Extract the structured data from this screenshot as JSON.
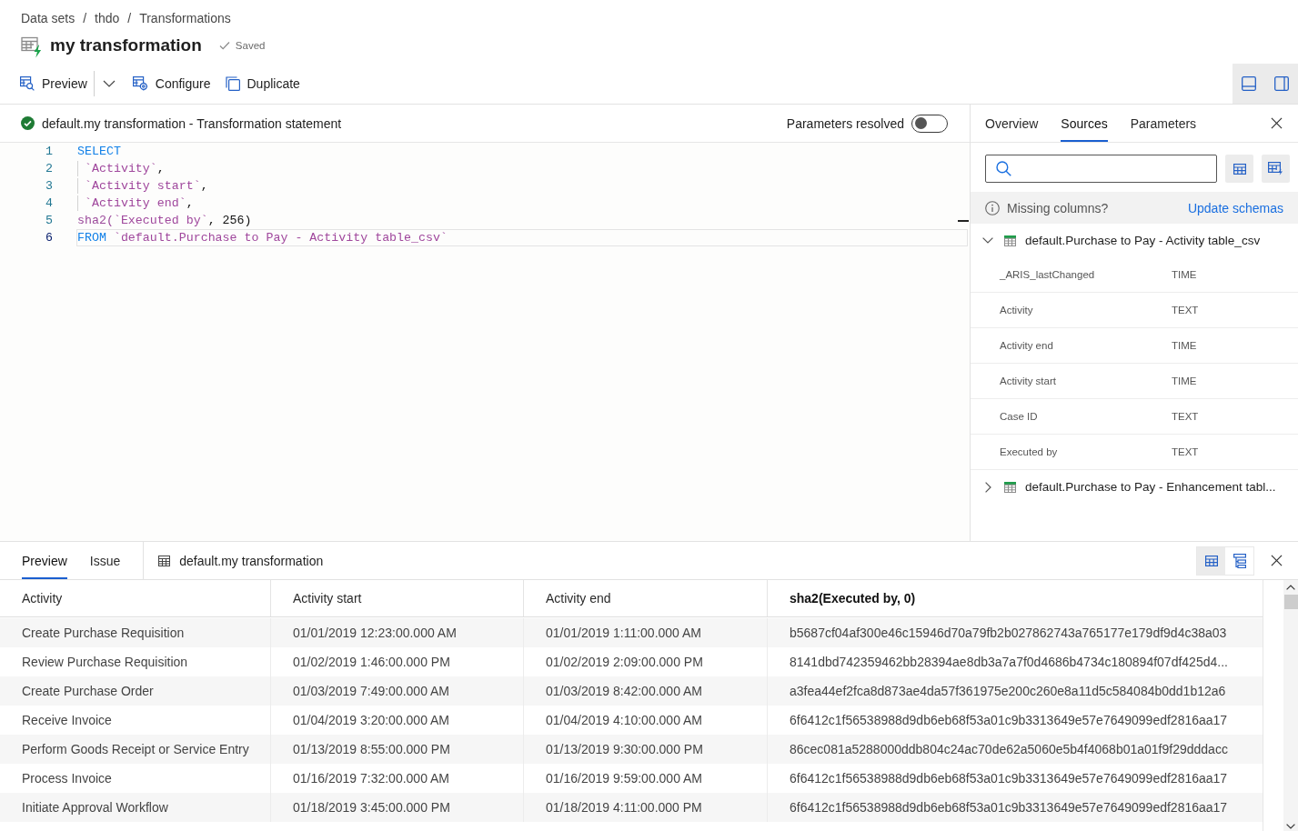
{
  "breadcrumb": {
    "separator": "/",
    "items": [
      "Data sets",
      "thdo",
      "Transformations"
    ]
  },
  "title": "my transformation",
  "save_status": "Saved",
  "toolbar": [
    {
      "kind": "preview",
      "label": "Preview"
    },
    {
      "kind": "dropdown"
    },
    {
      "kind": "configure",
      "label": "Configure"
    },
    {
      "kind": "duplicate",
      "label": "Duplicate"
    }
  ],
  "layout_toggles": [
    {
      "kind": "bottom-panel",
      "selected": true
    },
    {
      "kind": "side-panel",
      "selected": true
    }
  ],
  "editor": {
    "statement": {
      "title": "default.my transformation - Transformation statement",
      "valid": true
    },
    "parameters_resolved": {
      "label": "Parameters resolved",
      "on": false
    },
    "lines": [
      {
        "number": "1",
        "current": false,
        "indented": false,
        "tokens": [
          {
            "kind": "keyword",
            "text": "SELECT"
          }
        ]
      },
      {
        "number": "2",
        "current": false,
        "indented": true,
        "tokens": [
          {
            "kind": "string",
            "text": "`Activity`"
          },
          {
            "kind": "plain",
            "text": ","
          }
        ]
      },
      {
        "number": "3",
        "current": false,
        "indented": true,
        "tokens": [
          {
            "kind": "string",
            "text": "`Activity start`"
          },
          {
            "kind": "plain",
            "text": ","
          }
        ]
      },
      {
        "number": "4",
        "current": false,
        "indented": true,
        "tokens": [
          {
            "kind": "string",
            "text": "`Activity end`"
          },
          {
            "kind": "plain",
            "text": ","
          }
        ]
      },
      {
        "number": "5",
        "current": false,
        "indented": false,
        "tokens": [
          {
            "kind": "function",
            "text": "sha2("
          },
          {
            "kind": "string",
            "text": "`Executed by`"
          },
          {
            "kind": "plain",
            "text": ", 256)"
          }
        ]
      },
      {
        "number": "6",
        "current": true,
        "indented": false,
        "tokens": [
          {
            "kind": "keyword",
            "text": "FROM"
          },
          {
            "kind": "string",
            "text": " `default.Purchase to Pay - Activity table_csv`"
          }
        ]
      }
    ]
  },
  "side_panel": {
    "tabs": [
      {
        "label": "Overview",
        "selected": false
      },
      {
        "label": "Sources",
        "selected": true
      },
      {
        "label": "Parameters",
        "selected": false
      }
    ],
    "notice": {
      "text": "Missing columns?",
      "link": "Update schemas"
    },
    "sources": [
      {
        "name": "default.Purchase to Pay - Activity table_csv",
        "expanded": true,
        "children": [
          {
            "name": "_ARIS_lastChanged",
            "type": "TIME"
          },
          {
            "name": "Activity",
            "type": "TEXT"
          },
          {
            "name": "Activity end",
            "type": "TIME"
          },
          {
            "name": "Activity start",
            "type": "TIME"
          },
          {
            "name": "Case ID",
            "type": "TEXT"
          },
          {
            "name": "Executed by",
            "type": "TEXT"
          }
        ]
      },
      {
        "name": "default.Purchase to Pay - Enhancement tabl...",
        "expanded": false
      }
    ]
  },
  "bottom_panel": {
    "tabs": [
      {
        "label": "Preview",
        "selected": true
      },
      {
        "label": "Issue",
        "selected": false
      }
    ],
    "result_name": "default.my transformation",
    "view_toggles": [
      {
        "kind": "table",
        "selected": true
      },
      {
        "kind": "tree",
        "selected": false
      }
    ],
    "table": {
      "columns": [
        {
          "label": "Activity",
          "emphasized": false
        },
        {
          "label": "Activity start",
          "emphasized": false
        },
        {
          "label": "Activity end",
          "emphasized": false
        },
        {
          "label": "sha2(Executed by, 0)",
          "emphasized": true
        }
      ],
      "rows": [
        [
          "Create Purchase Requisition",
          "01/01/2019 12:23:00.000 AM",
          "01/01/2019 1:11:00.000 AM",
          "b5687cf04af300e46c15946d70a79fb2b027862743a765177e179df9d4c38a03"
        ],
        [
          "Review Purchase Requisition",
          "01/02/2019 1:46:00.000 PM",
          "01/02/2019 2:09:00.000 PM",
          "8141dbd742359462bb28394ae8db3a7a7f0d4686b4734c180894f07df425d4..."
        ],
        [
          "Create Purchase Order",
          "01/03/2019 7:49:00.000 AM",
          "01/03/2019 8:42:00.000 AM",
          "a3fea44ef2fca8d873ae4da57f361975e200c260e8a11d5c584084b0dd1b12a6"
        ],
        [
          "Receive Invoice",
          "01/04/2019 3:20:00.000 AM",
          "01/04/2019 4:10:00.000 AM",
          "6f6412c1f56538988d9db6eb68f53a01c9b3313649e57e7649099edf2816aa17"
        ],
        [
          "Perform Goods Receipt or Service Entry",
          "01/13/2019 8:55:00.000 PM",
          "01/13/2019 9:30:00.000 PM",
          "86cec081a5288000ddb804c24ac70de62a5060e5b4f4068b01a01f9f29dddacc"
        ],
        [
          "Process Invoice",
          "01/16/2019 7:32:00.000 AM",
          "01/16/2019 9:59:00.000 AM",
          "6f6412c1f56538988d9db6eb68f53a01c9b3313649e57e7649099edf2816aa17"
        ],
        [
          "Initiate Approval Workflow",
          "01/18/2019 3:45:00.000 PM",
          "01/18/2019 4:11:00.000 PM",
          "6f6412c1f56538988d9db6eb68f53a01c9b3313649e57e7649099edf2816aa17"
        ]
      ]
    }
  }
}
